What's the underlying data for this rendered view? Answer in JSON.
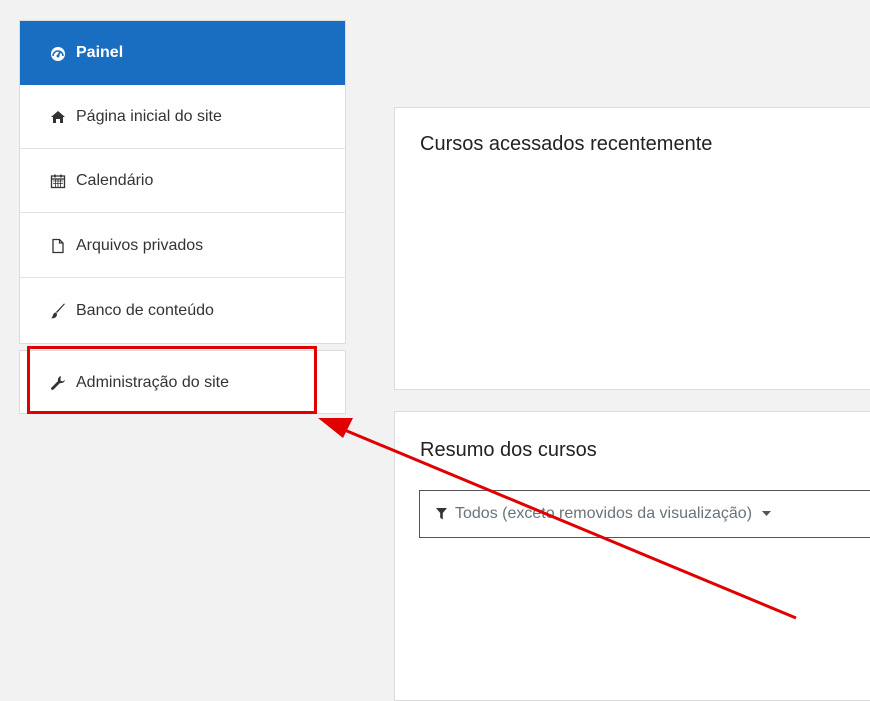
{
  "nav": {
    "items": [
      {
        "label": "Painel",
        "icon": "dashboard-icon",
        "active": true
      },
      {
        "label": "Página inicial do site",
        "icon": "home-icon"
      },
      {
        "label": "Calendário",
        "icon": "calendar-icon"
      },
      {
        "label": "Arquivos privados",
        "icon": "file-icon"
      },
      {
        "label": "Banco de conteúdo",
        "icon": "paintbrush-icon"
      }
    ],
    "admin": {
      "label": "Administração do site",
      "icon": "wrench-icon"
    }
  },
  "main": {
    "recent_courses_title": "Cursos acessados recentemente",
    "course_overview_title": "Resumo dos cursos",
    "filter_label": "Todos (exceto removidos da visualização)"
  },
  "colors": {
    "active_nav": "#1a6ec2",
    "annotation": "#e00000"
  }
}
